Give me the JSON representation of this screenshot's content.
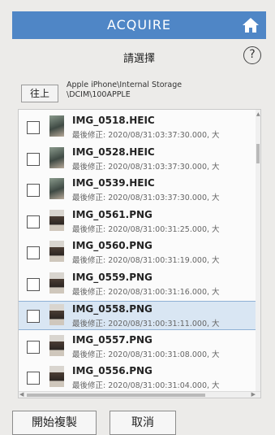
{
  "app": {
    "title": "ACQUIRE",
    "home_icon": "home-icon"
  },
  "subheader": {
    "label": "請選擇",
    "help_label": "?"
  },
  "path": {
    "up_label": "往上",
    "text": "Apple iPhone\\Internal Storage\n\\DCIM\\100APPLE"
  },
  "files": [
    {
      "name": "IMG_0518.HEIC",
      "meta": "最後修正: 2020/08/31:03:37:30.000, 大",
      "type": "heic",
      "selected": false
    },
    {
      "name": "IMG_0528.HEIC",
      "meta": "最後修正: 2020/08/31:03:37:30.000, 大",
      "type": "heic",
      "selected": false
    },
    {
      "name": "IMG_0539.HEIC",
      "meta": "最後修正: 2020/08/31:03:37:30.000, 大",
      "type": "heic",
      "selected": false
    },
    {
      "name": "IMG_0561.PNG",
      "meta": "最後修正: 2020/08/31:00:31:25.000, 大",
      "type": "png",
      "selected": false
    },
    {
      "name": "IMG_0560.PNG",
      "meta": "最後修正: 2020/08/31:00:31:19.000, 大",
      "type": "png",
      "selected": false
    },
    {
      "name": "IMG_0559.PNG",
      "meta": "最後修正: 2020/08/31:00:31:16.000, 大",
      "type": "png",
      "selected": false
    },
    {
      "name": "IMG_0558.PNG",
      "meta": "最後修正: 2020/08/31:00:31:11.000, 大",
      "type": "png",
      "selected": true
    },
    {
      "name": "IMG_0557.PNG",
      "meta": "最後修正: 2020/08/31:00:31:08.000, 大",
      "type": "png",
      "selected": false
    },
    {
      "name": "IMG_0556.PNG",
      "meta": "最後修正: 2020/08/31:00:31:04.000, 大",
      "type": "png",
      "selected": false
    }
  ],
  "buttons": {
    "start": "開始複製",
    "cancel": "取消"
  },
  "colors": {
    "accent": "#4f86c6",
    "selected_row": "#d9e6f3"
  }
}
